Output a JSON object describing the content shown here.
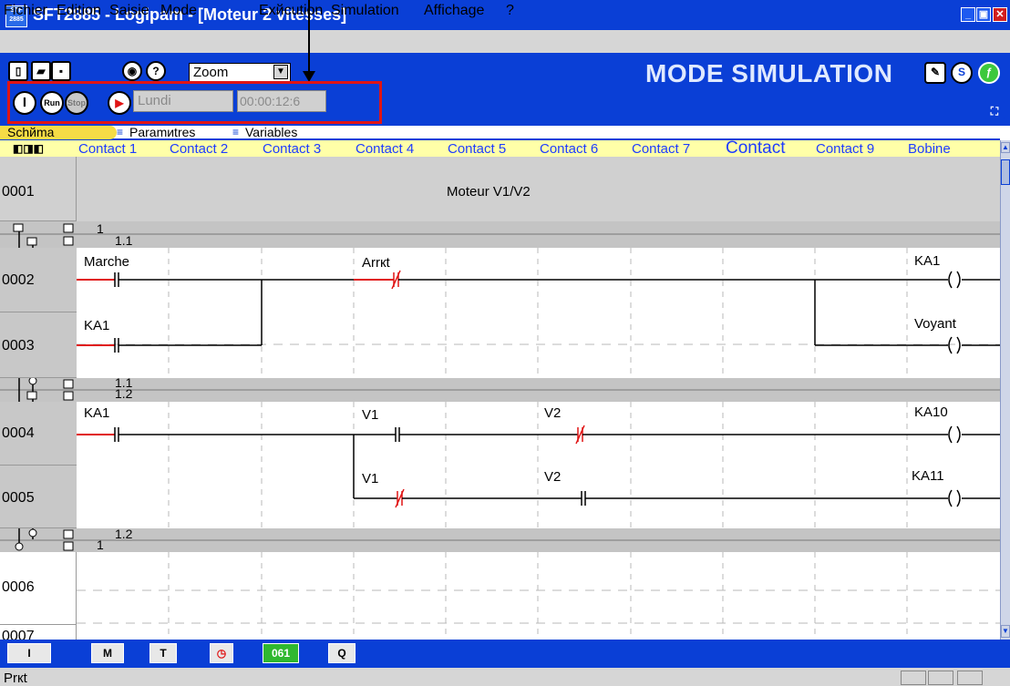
{
  "window": {
    "title": "SFT2885 - Logipam - [Moteur 2 vitesses]",
    "icon_text": "STF 2885"
  },
  "menu": [
    "Fichier",
    "Edition",
    "Saisie",
    "Mode",
    "Exйcution",
    "Simulation",
    "Affichage",
    "?"
  ],
  "toolbar": {
    "zoom_value": "Zoom",
    "mode_label": "MODE SIMULATION",
    "run_label": "Run",
    "stop_label": "Stop",
    "day": "Lundi",
    "time": "00:00:12:6",
    "s_label": "S"
  },
  "tabs": [
    "Schйma",
    "Paramиtres",
    "Variables"
  ],
  "columns": [
    "Contact 1",
    "Contact 2",
    "Contact 3",
    "Contact 4",
    "Contact 5",
    "Contact 6",
    "Contact 7",
    "Contact",
    "Contact 9",
    "Bobine"
  ],
  "rows": {
    "r0001": {
      "num": "0001",
      "comment": "Moteur V1/V2"
    },
    "sep1": {
      "a": "1",
      "b": "1.1"
    },
    "r0002": {
      "num": "0002",
      "c1": "Marche",
      "c4": "Arrкt",
      "coil": "KA1"
    },
    "r0003": {
      "num": "0003",
      "c1": "KA1",
      "coil": "Voyant"
    },
    "sep2": {
      "a": "1.1",
      "b": "1.2"
    },
    "r0004": {
      "num": "0004",
      "c1": "KA1",
      "c4": "V1",
      "c6": "V2",
      "coil": "KA10"
    },
    "r0005": {
      "num": "0005",
      "c4": "V1",
      "c6": "V2",
      "coil": "KA11"
    },
    "sep3": {
      "a": "1.2",
      "b": "1"
    },
    "r0006": {
      "num": "0006"
    },
    "r0007": {
      "num": "0007"
    }
  },
  "bottom_tools": [
    "I",
    "M",
    "T",
    "",
    "061",
    "Q"
  ],
  "status": {
    "text": "Prкt"
  },
  "colors": {
    "blue": "#0a3fd6",
    "active_line": "#e01414",
    "column_text": "#1e3cff",
    "header_bg": "#ffffa8"
  }
}
